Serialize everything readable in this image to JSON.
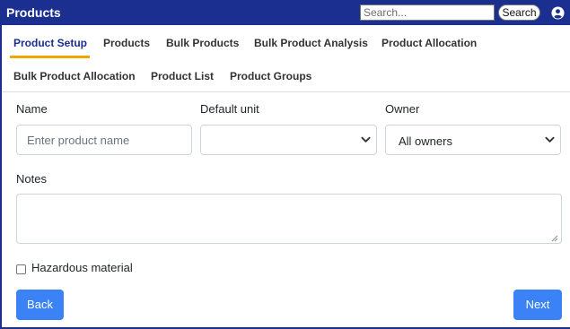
{
  "header": {
    "title": "Products",
    "search_placeholder": "Search...",
    "search_button": "Search",
    "user_icon": "user-icon"
  },
  "tabs": [
    {
      "label": "Product Setup",
      "active": true
    },
    {
      "label": "Products",
      "active": false
    },
    {
      "label": "Bulk Products",
      "active": false
    },
    {
      "label": "Bulk Product Analysis",
      "active": false
    },
    {
      "label": "Product Allocation",
      "active": false
    },
    {
      "label": "Bulk Product Allocation",
      "active": false
    },
    {
      "label": "Product List",
      "active": false
    },
    {
      "label": "Product Groups",
      "active": false
    }
  ],
  "form": {
    "name_label": "Name",
    "name_placeholder": "Enter product name",
    "name_value": "",
    "unit_label": "Default unit",
    "unit_value": "",
    "owner_label": "Owner",
    "owner_value": "All owners",
    "notes_label": "Notes",
    "notes_value": "",
    "hazardous_label": "Hazardous material",
    "hazardous_checked": false
  },
  "actions": {
    "back": "Back",
    "next": "Next"
  },
  "colors": {
    "header_bg": "#1a2f8f",
    "active_tab_underline": "#f0a500",
    "button_bg": "#3b82f6"
  }
}
